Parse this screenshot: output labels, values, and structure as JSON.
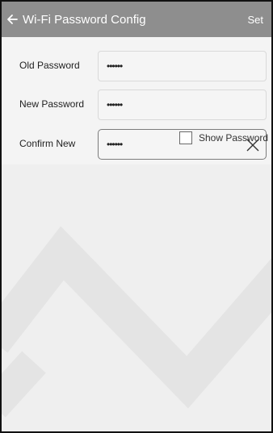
{
  "header": {
    "back_icon": "arrow-left-icon",
    "title": "Wi-Fi Password Config",
    "action_label": "Set"
  },
  "form": {
    "old_password": {
      "label": "Old Password",
      "value": "••••••"
    },
    "new_password": {
      "label": "New Password",
      "value": "••••••"
    },
    "confirm_new": {
      "label": "Confirm New",
      "value": "••••••",
      "clear_icon": "close-icon"
    },
    "show_password": {
      "label": "Show Password",
      "checked": false
    }
  },
  "colors": {
    "header_bg": "#8e8e8e",
    "page_bg": "#efefef",
    "form_bg": "#f4f4f4",
    "watermark": "#e4e4e4"
  }
}
